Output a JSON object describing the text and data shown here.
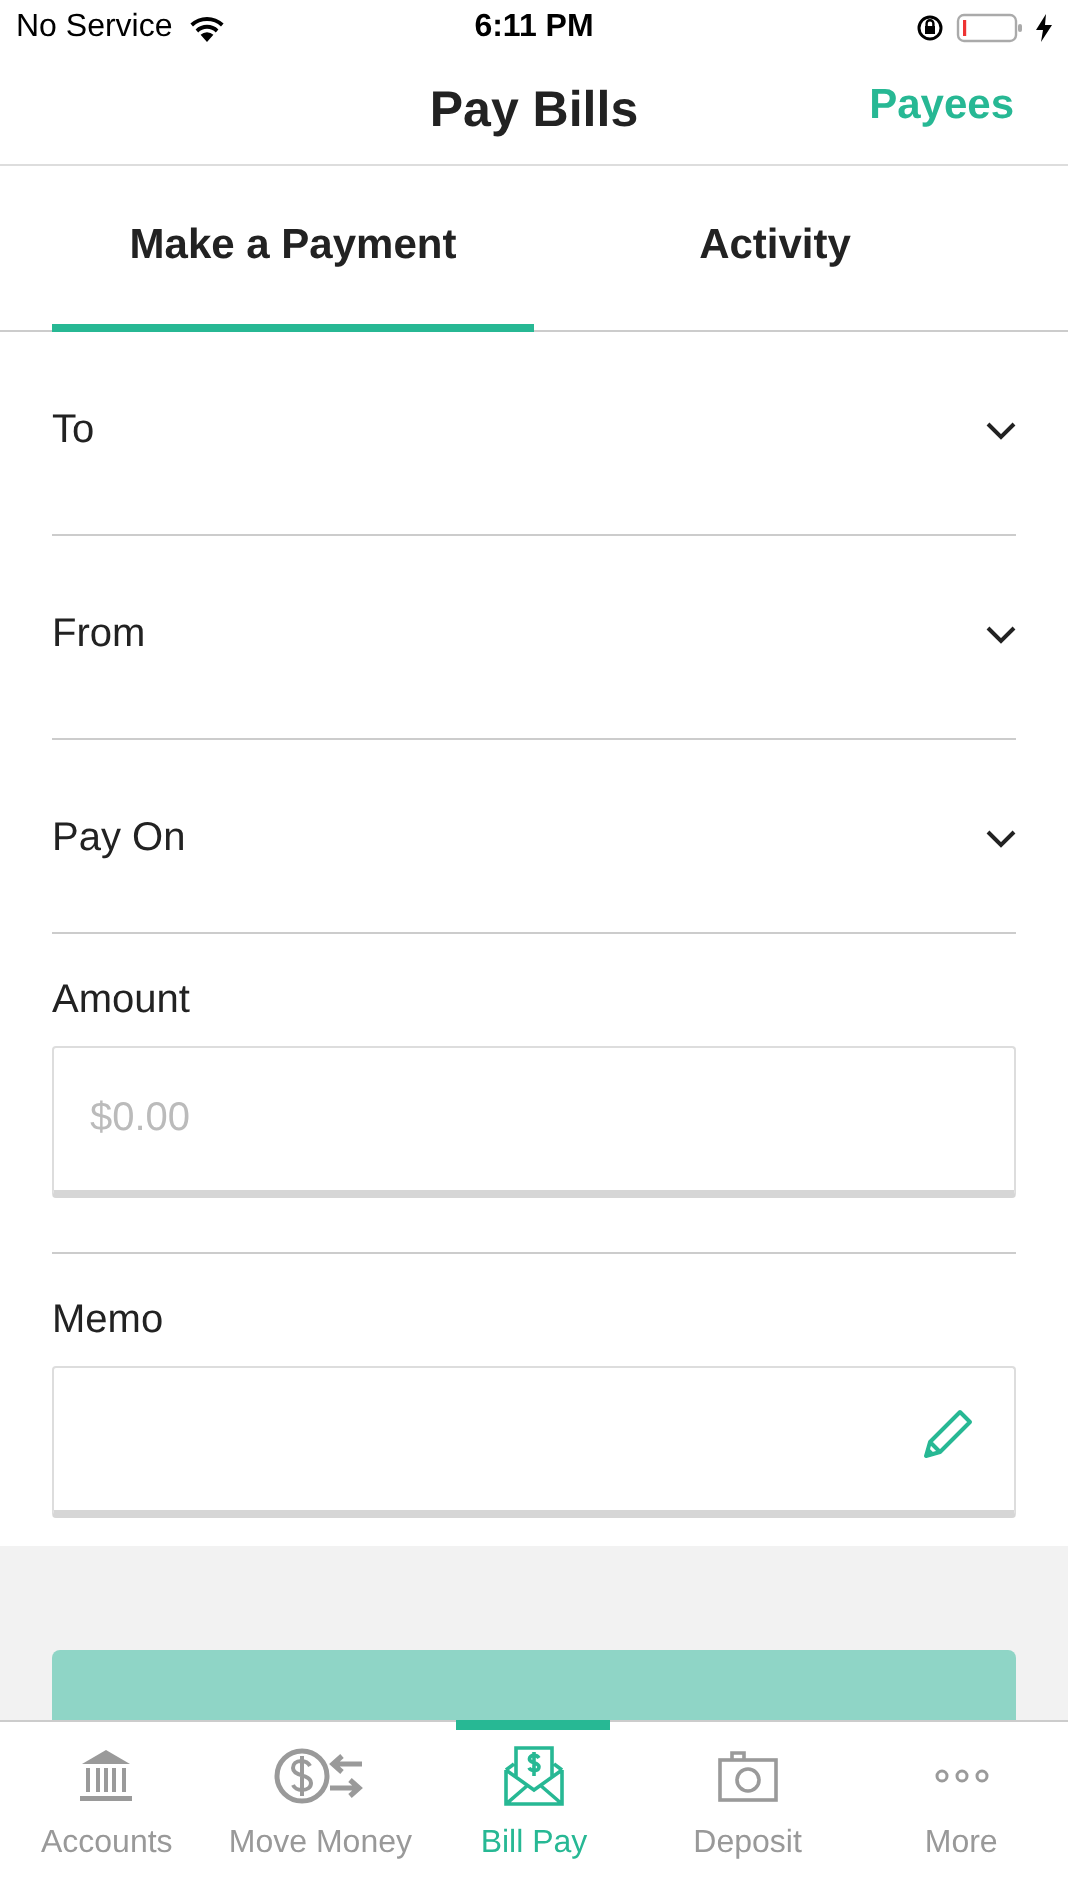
{
  "status_bar": {
    "carrier": "No Service",
    "time": "6:11 PM"
  },
  "header": {
    "title": "Pay Bills",
    "action": "Payees"
  },
  "tabs": [
    {
      "label": "Make a Payment",
      "selected": true
    },
    {
      "label": "Activity",
      "selected": false
    }
  ],
  "fields": [
    {
      "kind": "dropdown",
      "label": "To"
    },
    {
      "kind": "dropdown",
      "label": "From"
    },
    {
      "kind": "dropdown",
      "label": "Pay On"
    },
    {
      "kind": "input",
      "label": "Amount",
      "placeholder": "$0.00"
    },
    {
      "kind": "memo",
      "label": "Memo"
    }
  ],
  "tab_bar": [
    {
      "kind": "bank",
      "label": "Accounts",
      "selected": false
    },
    {
      "kind": "exchange",
      "label": "Move Money",
      "selected": false
    },
    {
      "kind": "bill",
      "label": "Bill Pay",
      "selected": true
    },
    {
      "kind": "camera",
      "label": "Deposit",
      "selected": false
    },
    {
      "kind": "more",
      "label": "More",
      "selected": false
    }
  ]
}
